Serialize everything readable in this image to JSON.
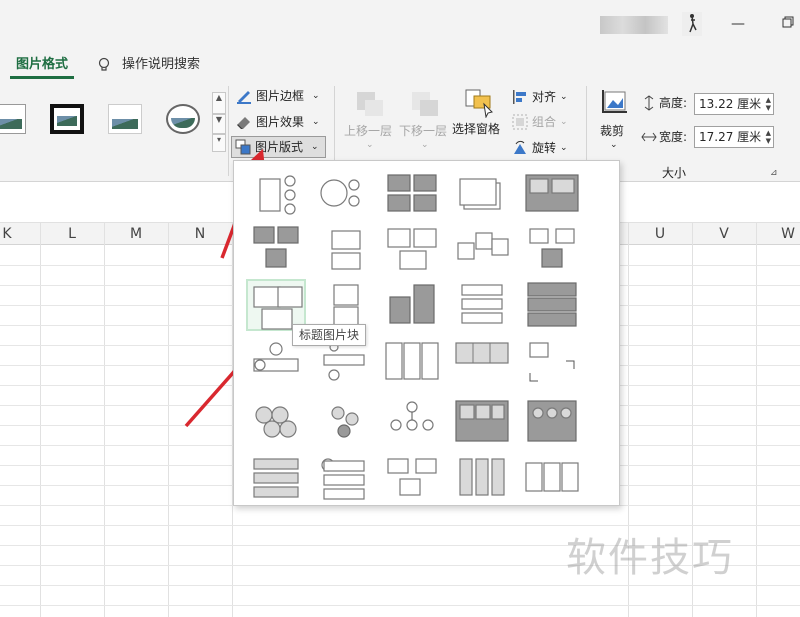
{
  "ribbon": {
    "tabs": [
      {
        "label": "图片格式"
      },
      {
        "label": "操作说明搜索"
      }
    ],
    "picture_styles_group": {
      "picture_border": "图片边框",
      "picture_effects": "图片效果",
      "picture_layout": "图片版式"
    },
    "arrange_group": {
      "bring_forward": "上移一层",
      "send_backward": "下移一层",
      "selection_pane": "选择窗格",
      "align": "对齐",
      "group": "组合",
      "rotate": "旋转"
    },
    "size_group": {
      "crop": "裁剪",
      "height_label": "高度:",
      "height_value": "13.22 厘米",
      "width_label": "宽度:",
      "width_value": "17.27 厘米",
      "group_label": "大小"
    }
  },
  "sheet": {
    "columns": [
      "K",
      "L",
      "M",
      "N",
      "U",
      "V",
      "W"
    ]
  },
  "layout_gallery": {
    "tooltip": "标题图片块",
    "selected_index": 10,
    "item_count": 30
  },
  "watermark": "软件技巧",
  "colors": {
    "accent_green": "#1e6e42",
    "arrow_red": "#d9282f",
    "selected_highlight": "#c5e7cf"
  }
}
